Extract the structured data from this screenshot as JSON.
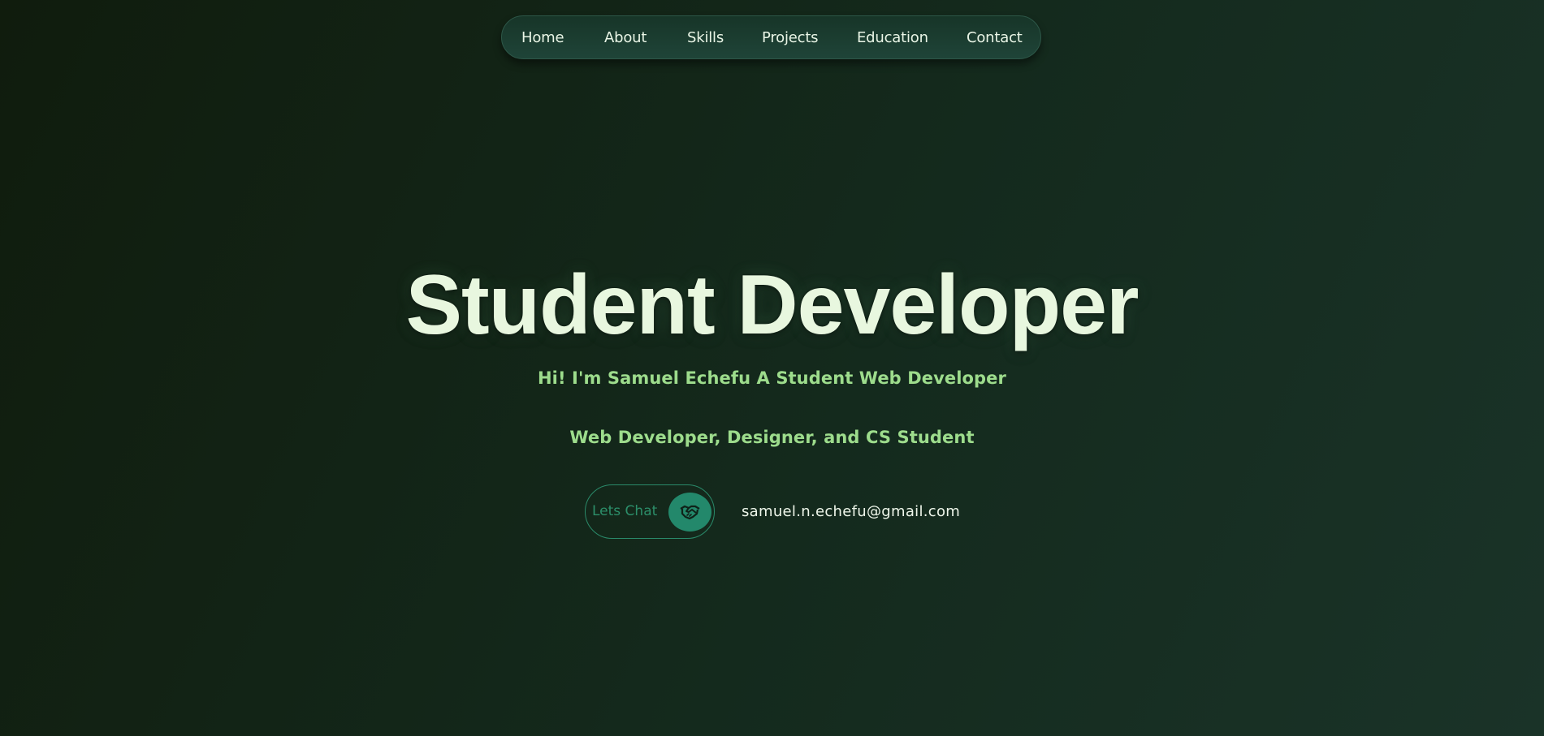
{
  "nav": {
    "items": [
      {
        "label": "Home"
      },
      {
        "label": "About"
      },
      {
        "label": "Skills"
      },
      {
        "label": "Projects"
      },
      {
        "label": "Education"
      },
      {
        "label": "Contact"
      }
    ]
  },
  "hero": {
    "title": "Student Developer",
    "intro": "Hi! I'm Samuel Echefu A Student Web Developer",
    "roles": "Web Developer, Designer, and CS Student"
  },
  "cta": {
    "chat_label": "Lets Chat",
    "chat_icon": "handshake-icon",
    "email": "samuel.n.echefu@gmail.com"
  },
  "colors": {
    "background": "#132619",
    "nav_background": "#1c3e33",
    "title": "#e8f7df",
    "subtitle": "#9ddc8c",
    "accent": "#23886b",
    "text": "#eef6ea"
  }
}
